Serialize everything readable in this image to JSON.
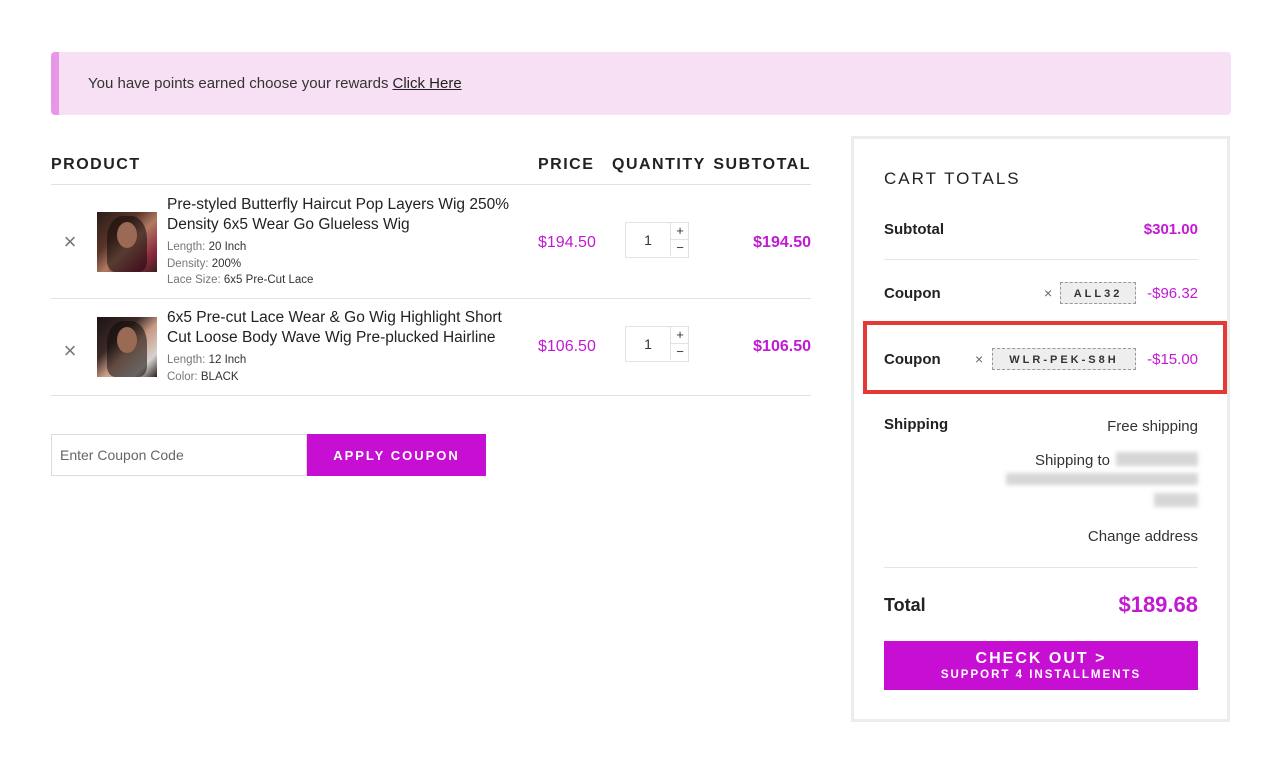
{
  "notice": {
    "text": "You have points earned choose your rewards",
    "link": "Click Here"
  },
  "table": {
    "headers": {
      "product": "PRODUCT",
      "price": "PRICE",
      "quantity": "QUANTITY",
      "subtotal": "SUBTOTAL"
    },
    "items": [
      {
        "name_line1": "Pre-styled Butterfly Haircut Pop Layers Wig 250%",
        "name_line2": "Density 6x5 Wear Go Glueless Wig",
        "attrs": [
          {
            "label": "Length:",
            "value": "20 Inch"
          },
          {
            "label": "Density:",
            "value": "200%"
          },
          {
            "label": "Lace Size:",
            "value": "6x5 Pre-Cut Lace"
          }
        ],
        "price": "$194.50",
        "quantity": "1",
        "subtotal": "$194.50"
      },
      {
        "name_line1": "6x5 Pre-cut Lace Wear & Go Wig Highlight Short",
        "name_line2": "Cut Loose Body Wave Wig Pre-plucked Hairline",
        "attrs": [
          {
            "label": "Length:",
            "value": "12 Inch"
          },
          {
            "label": "Color:",
            "value": "BLACK"
          }
        ],
        "price": "$106.50",
        "quantity": "1",
        "subtotal": "$106.50"
      }
    ],
    "remove_symbol": "×",
    "plus": "+",
    "minus": "−"
  },
  "coupon_form": {
    "placeholder": "Enter Coupon Code",
    "button": "APPLY COUPON"
  },
  "totals": {
    "title": "CART TOTALS",
    "subtotal_label": "Subtotal",
    "subtotal_value": "$301.00",
    "coupons": [
      {
        "label": "Coupon",
        "code": "ALL32",
        "amount": "-$96.32"
      },
      {
        "label": "Coupon",
        "code": "WLR-PEK-S8H",
        "amount": "-$15.00"
      }
    ],
    "shipping_label": "Shipping",
    "shipping_method": "Free shipping",
    "shipping_to": "Shipping to",
    "change_address": "Change address",
    "total_label": "Total",
    "total_value": "$189.68",
    "checkout_line1": "CHECK OUT >",
    "checkout_line2": "SUPPORT 4 INSTALLMENTS"
  },
  "colors": {
    "accent": "#c70fd4",
    "price": "#c21ad3",
    "notice_bg": "#f7dff4",
    "highlight": "#e53935"
  }
}
